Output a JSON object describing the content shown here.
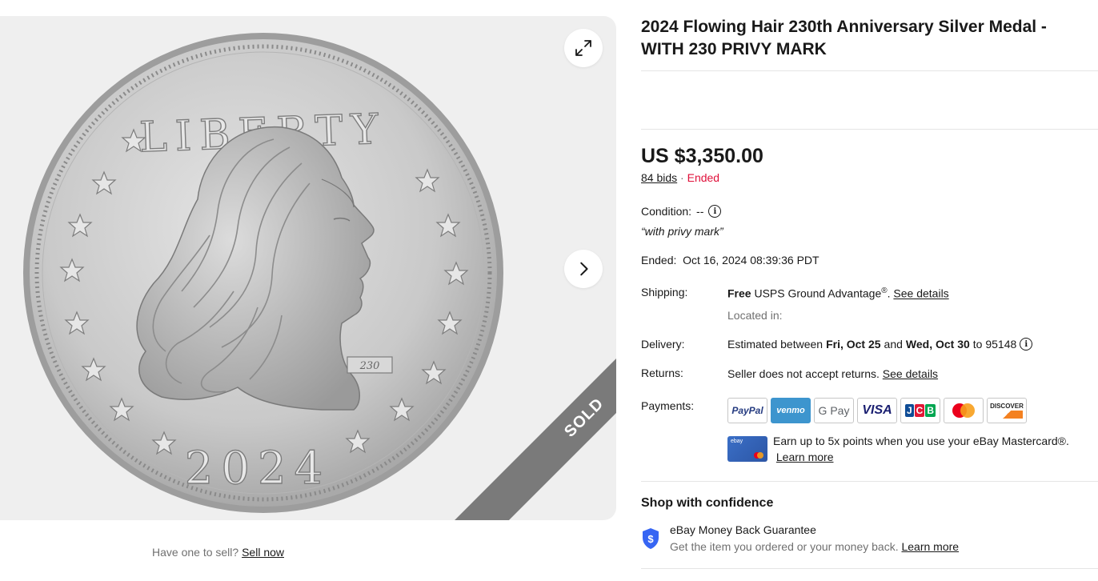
{
  "listing": {
    "title": "2024 Flowing Hair 230th Anniversary Silver Medal - WITH 230 PRIVY MARK",
    "price": "US $3,350.00",
    "bids": "84 bids",
    "separator": "·",
    "status": "Ended",
    "condition_label": "Condition:",
    "condition_value": "--",
    "condition_quote": "“with privy mark”",
    "ended_label": "Ended:",
    "ended_value": "Oct 16, 2024 08:39:36 PDT"
  },
  "gallery": {
    "sold_ribbon": "SOLD",
    "coin_legend": "LIBERTY",
    "coin_year": "2024",
    "coin_privy": "230"
  },
  "sell": {
    "prompt": "Have one to sell?",
    "link": "Sell now"
  },
  "shipping": {
    "label": "Shipping:",
    "free": "Free",
    "service": "USPS Ground Advantage",
    "reg": "®",
    "period": ".",
    "details_link": "See details",
    "located": "Located in:"
  },
  "delivery": {
    "label": "Delivery:",
    "prefix": "Estimated between",
    "date1": "Fri, Oct 25",
    "and": "and",
    "date2": "Wed, Oct 30",
    "to": "to 95148"
  },
  "returns": {
    "label": "Returns:",
    "text": "Seller does not accept returns.",
    "details_link": "See details"
  },
  "payments": {
    "label": "Payments:",
    "methods": [
      "PayPal",
      "venmo",
      "G Pay",
      "VISA",
      "JCB",
      "Mastercard",
      "DISCOVER"
    ],
    "card_label": "ebay",
    "mastercard_text": "Earn up to 5x points when you use your eBay Mastercard®.",
    "learn_more": "Learn more"
  },
  "confidence": {
    "title": "Shop with confidence",
    "guarantee_title": "eBay Money Back Guarantee",
    "guarantee_desc": "Get the item you ordered or your money back.",
    "learn_more": "Learn more"
  },
  "colors": {
    "ended": "#e0103a",
    "text": "#191919",
    "muted": "#707070",
    "shield": "#3665f3"
  }
}
